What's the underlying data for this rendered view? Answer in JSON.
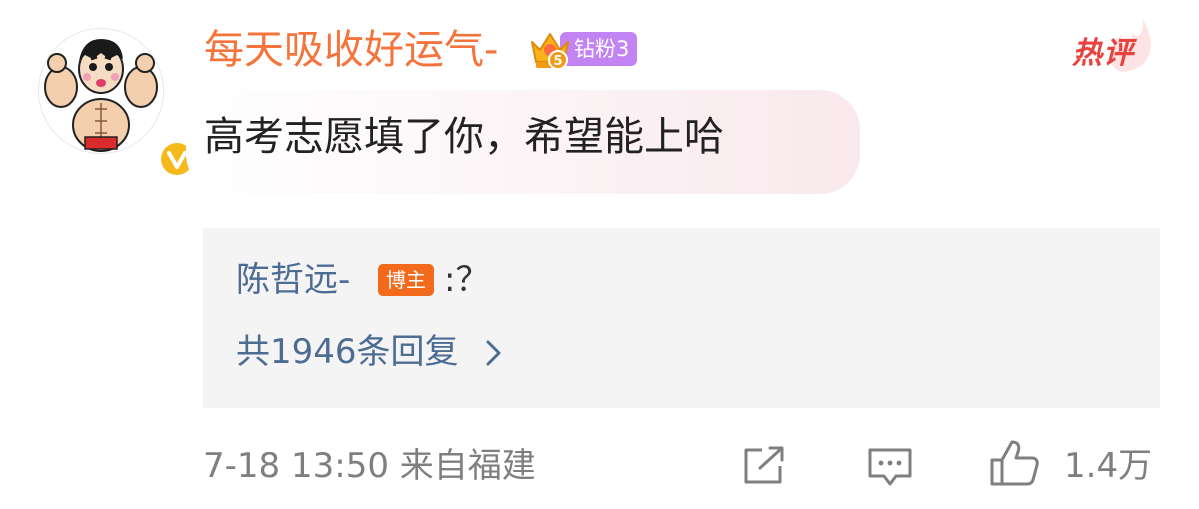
{
  "comment": {
    "username": "每天吸收好运气-",
    "fan_badge": "钻粉3",
    "crown_level": "5",
    "hot_tag": "热评",
    "text": "高考志愿填了你，希望能上哈",
    "avatar_icon": "cartoon-muscle-avatar",
    "verified_icon": "verified-v-badge"
  },
  "reply": {
    "author": "陈哲远-",
    "author_tag": "博主",
    "text": ":？",
    "count_label": "共1946条回复"
  },
  "footer": {
    "meta": "7-18 13:50  来自福建",
    "like_count": "1.4万",
    "share_icon": "share-icon",
    "comment_icon": "comment-icon",
    "like_icon": "thumbs-up-icon"
  },
  "colors": {
    "username": "#f5743b",
    "fan_badge": "#c283f3",
    "hot_tag": "#e8423f",
    "link": "#4d6c94",
    "blogger_tag": "#f36a1d",
    "meta": "#7f7f7f"
  }
}
